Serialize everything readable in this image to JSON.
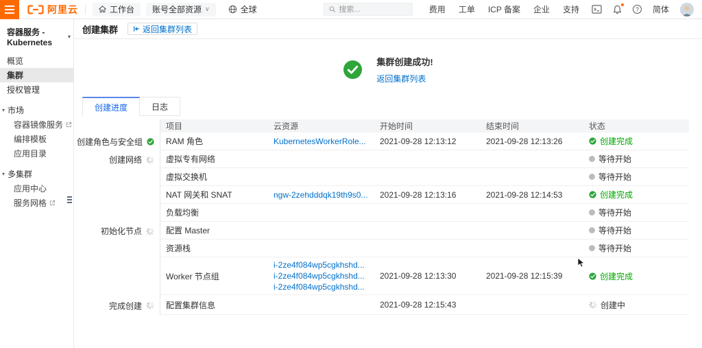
{
  "colors": {
    "brand_orange": "#ff6a00",
    "link_blue": "#0070cc",
    "tab_blue": "#1366ec",
    "success_green": "#00a700",
    "waiting_gray": "#bcbcbc"
  },
  "topbar": {
    "logo_text": "阿里云",
    "workbench": "工作台",
    "resource_scope": "账号全部资源",
    "region": "全球",
    "search_placeholder": "搜索...",
    "menu": [
      "费用",
      "工单",
      "ICP 备案",
      "企业",
      "支持"
    ],
    "icons": [
      "cloudshell-icon",
      "bell-icon",
      "help-icon"
    ],
    "language": "简体"
  },
  "sidebar": {
    "title": "容器服务 - Kubernetes",
    "items": [
      {
        "label": "概览",
        "type": "item",
        "active": false,
        "external": false
      },
      {
        "label": "集群",
        "type": "item",
        "active": true,
        "external": false
      },
      {
        "label": "授权管理",
        "type": "item",
        "active": false,
        "external": false
      },
      {
        "label": "市场",
        "type": "group",
        "active": false,
        "external": false
      },
      {
        "label": "容器镜像服务",
        "type": "sub",
        "active": false,
        "external": true
      },
      {
        "label": "编排模板",
        "type": "sub",
        "active": false,
        "external": false
      },
      {
        "label": "应用目录",
        "type": "sub",
        "active": false,
        "external": false
      },
      {
        "label": "多集群",
        "type": "group",
        "active": false,
        "external": false
      },
      {
        "label": "应用中心",
        "type": "sub",
        "active": false,
        "external": false
      },
      {
        "label": "服务网格",
        "type": "sub",
        "active": false,
        "external": true
      }
    ]
  },
  "header": {
    "title": "创建集群",
    "back_button": "返回集群列表"
  },
  "success": {
    "message": "集群创建成功!",
    "link": "返回集群列表"
  },
  "tabs": [
    {
      "label": "创建进度",
      "active": true
    },
    {
      "label": "日志",
      "active": false
    }
  ],
  "stages": [
    {
      "label": "创建角色与安全组",
      "status": "done",
      "align_row": 0
    },
    {
      "label": "创建网络",
      "status": "running",
      "align_row": 1
    },
    {
      "label": "初始化节点",
      "status": "running",
      "align_row": 5
    },
    {
      "label": "完成创建",
      "status": "running",
      "align_row": 8
    }
  ],
  "table": {
    "columns": [
      "项目",
      "云资源",
      "开始时间",
      "结束时间",
      "状态"
    ],
    "rows": [
      {
        "item": "RAM 角色",
        "resources": [
          "KubernetesWorkerRole..."
        ],
        "start": "2021-09-28 12:13:12",
        "end": "2021-09-28 12:13:26",
        "status": {
          "type": "done",
          "label": "创建完成"
        }
      },
      {
        "item": "虚拟专有网络",
        "resources": [],
        "start": "",
        "end": "",
        "status": {
          "type": "waiting",
          "label": "等待开始"
        }
      },
      {
        "item": "虚拟交换机",
        "resources": [],
        "start": "",
        "end": "",
        "status": {
          "type": "waiting",
          "label": "等待开始"
        }
      },
      {
        "item": "NAT 网关和 SNAT",
        "resources": [
          "ngw-2zehdddqk19th9s0..."
        ],
        "start": "2021-09-28 12:13:16",
        "end": "2021-09-28 12:14:53",
        "status": {
          "type": "done",
          "label": "创建完成"
        }
      },
      {
        "item": "负载均衡",
        "resources": [],
        "start": "",
        "end": "",
        "status": {
          "type": "waiting",
          "label": "等待开始"
        }
      },
      {
        "item": "配置 Master",
        "resources": [],
        "start": "",
        "end": "",
        "status": {
          "type": "waiting",
          "label": "等待开始"
        }
      },
      {
        "item": "资源栈",
        "resources": [],
        "start": "",
        "end": "",
        "status": {
          "type": "waiting",
          "label": "等待开始"
        }
      },
      {
        "item": "Worker 节点组",
        "resources": [
          "i-2ze4f084wp5cgkhshd...",
          "i-2ze4f084wp5cgkhshd...",
          "i-2ze4f084wp5cgkhshd..."
        ],
        "start": "2021-09-28 12:13:30",
        "end": "2021-09-28 12:15:39",
        "status": {
          "type": "done",
          "label": "创建完成"
        }
      },
      {
        "item": "配置集群信息",
        "resources": [],
        "start": "2021-09-28 12:15:43",
        "end": "",
        "status": {
          "type": "running",
          "label": "创建中"
        }
      }
    ]
  }
}
